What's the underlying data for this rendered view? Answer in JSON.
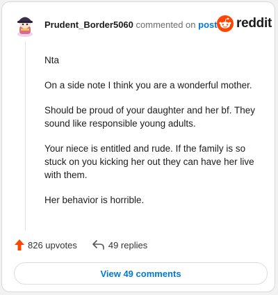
{
  "header": {
    "username": "Prudent_Border5060",
    "commented_text": "commented on",
    "post_link": "post",
    "brand": "reddit"
  },
  "comment": {
    "paragraphs": [
      "Nta",
      "On a side note I think you are a wonderful mother.",
      "Should be proud of your daughter and her bf. They sound like responsible young adults.",
      "Your niece is entitled and rude. If the family is so stuck on you kicking her out they can have her live with them.",
      "Her behavior is horrible."
    ]
  },
  "actions": {
    "upvotes": "826 upvotes",
    "replies": "49 replies"
  },
  "view_comments_label": "View 49 comments",
  "colors": {
    "brand_orange": "#ff4500",
    "link_blue": "#0079d3",
    "upvote_orange": "#ff4500"
  },
  "icons": [
    "avatar",
    "reddit-logo-icon",
    "upvote-arrow-icon",
    "reply-arrow-icon"
  ]
}
